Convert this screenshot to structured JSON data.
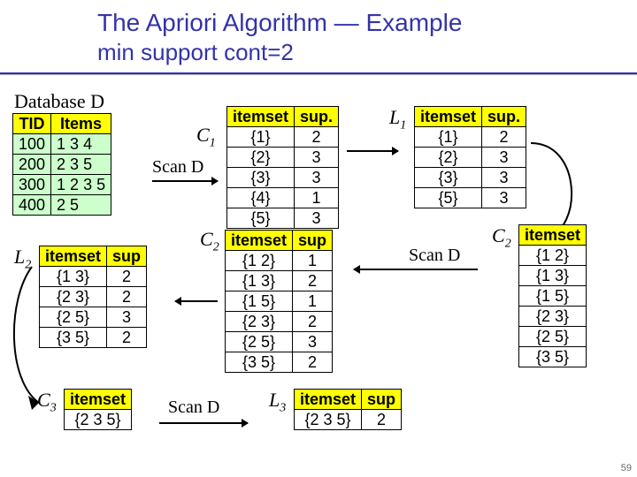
{
  "title": "The Apriori Algorithm — Example",
  "subtitle": "min support cont=2",
  "labels": {
    "databaseD": "Database D",
    "C1": "C",
    "C1sub": "1",
    "L1": "L",
    "L1sub": "1",
    "C2": "C",
    "C2sub": "2",
    "L2": "L",
    "L2sub": "2",
    "C3": "C",
    "C3sub": "3",
    "L3": "L",
    "L3sub": "3",
    "scanD": "Scan D"
  },
  "pagenum": "59",
  "databaseD": {
    "headers": [
      "TID",
      "Items"
    ],
    "rows": [
      [
        "100",
        "1 3 4"
      ],
      [
        "200",
        "2 3 5"
      ],
      [
        "300",
        "1 2 3 5"
      ],
      [
        "400",
        "2 5"
      ]
    ]
  },
  "C1": {
    "headers": [
      "itemset",
      "sup."
    ],
    "rows": [
      [
        "{1}",
        "2"
      ],
      [
        "{2}",
        "3"
      ],
      [
        "{3}",
        "3"
      ],
      [
        "{4}",
        "1"
      ],
      [
        "{5}",
        "3"
      ]
    ]
  },
  "L1": {
    "headers": [
      "itemset",
      "sup."
    ],
    "rows": [
      [
        "{1}",
        "2"
      ],
      [
        "{2}",
        "3"
      ],
      [
        "{3}",
        "3"
      ],
      [
        "{5}",
        "3"
      ]
    ]
  },
  "C2cand": {
    "headers": [
      "itemset"
    ],
    "rows": [
      [
        "{1 2}"
      ],
      [
        "{1 3}"
      ],
      [
        "{1 5}"
      ],
      [
        "{2 3}"
      ],
      [
        "{2 5}"
      ],
      [
        "{3 5}"
      ]
    ]
  },
  "C2sup": {
    "headers": [
      "itemset",
      "sup"
    ],
    "rows": [
      [
        "{1 2}",
        "1"
      ],
      [
        "{1 3}",
        "2"
      ],
      [
        "{1 5}",
        "1"
      ],
      [
        "{2 3}",
        "2"
      ],
      [
        "{2 5}",
        "3"
      ],
      [
        "{3 5}",
        "2"
      ]
    ]
  },
  "L2": {
    "headers": [
      "itemset",
      "sup"
    ],
    "rows": [
      [
        "{1 3}",
        "2"
      ],
      [
        "{2 3}",
        "2"
      ],
      [
        "{2 5}",
        "3"
      ],
      [
        "{3 5}",
        "2"
      ]
    ]
  },
  "C3": {
    "headers": [
      "itemset"
    ],
    "rows": [
      [
        "{2 3 5}"
      ]
    ]
  },
  "L3": {
    "headers": [
      "itemset",
      "sup"
    ],
    "rows": [
      [
        "{2 3 5}",
        "2"
      ]
    ]
  },
  "chart_data": {
    "type": "table",
    "title": "The Apriori Algorithm — Example",
    "min_support": 2,
    "database": [
      {
        "TID": 100,
        "items": [
          1,
          3,
          4
        ]
      },
      {
        "TID": 200,
        "items": [
          2,
          3,
          5
        ]
      },
      {
        "TID": 300,
        "items": [
          1,
          2,
          3,
          5
        ]
      },
      {
        "TID": 400,
        "items": [
          2,
          5
        ]
      }
    ],
    "C1": [
      {
        "itemset": [
          1
        ],
        "sup": 2
      },
      {
        "itemset": [
          2
        ],
        "sup": 3
      },
      {
        "itemset": [
          3
        ],
        "sup": 3
      },
      {
        "itemset": [
          4
        ],
        "sup": 1
      },
      {
        "itemset": [
          5
        ],
        "sup": 3
      }
    ],
    "L1": [
      {
        "itemset": [
          1
        ],
        "sup": 2
      },
      {
        "itemset": [
          2
        ],
        "sup": 3
      },
      {
        "itemset": [
          3
        ],
        "sup": 3
      },
      {
        "itemset": [
          5
        ],
        "sup": 3
      }
    ],
    "C2_candidates": [
      [
        1,
        2
      ],
      [
        1,
        3
      ],
      [
        1,
        5
      ],
      [
        2,
        3
      ],
      [
        2,
        5
      ],
      [
        3,
        5
      ]
    ],
    "C2": [
      {
        "itemset": [
          1,
          2
        ],
        "sup": 1
      },
      {
        "itemset": [
          1,
          3
        ],
        "sup": 2
      },
      {
        "itemset": [
          1,
          5
        ],
        "sup": 1
      },
      {
        "itemset": [
          2,
          3
        ],
        "sup": 2
      },
      {
        "itemset": [
          2,
          5
        ],
        "sup": 3
      },
      {
        "itemset": [
          3,
          5
        ],
        "sup": 2
      }
    ],
    "L2": [
      {
        "itemset": [
          1,
          3
        ],
        "sup": 2
      },
      {
        "itemset": [
          2,
          3
        ],
        "sup": 2
      },
      {
        "itemset": [
          2,
          5
        ],
        "sup": 3
      },
      {
        "itemset": [
          3,
          5
        ],
        "sup": 2
      }
    ],
    "C3_candidates": [
      [
        2,
        3,
        5
      ]
    ],
    "L3": [
      {
        "itemset": [
          2,
          3,
          5
        ],
        "sup": 2
      }
    ]
  }
}
